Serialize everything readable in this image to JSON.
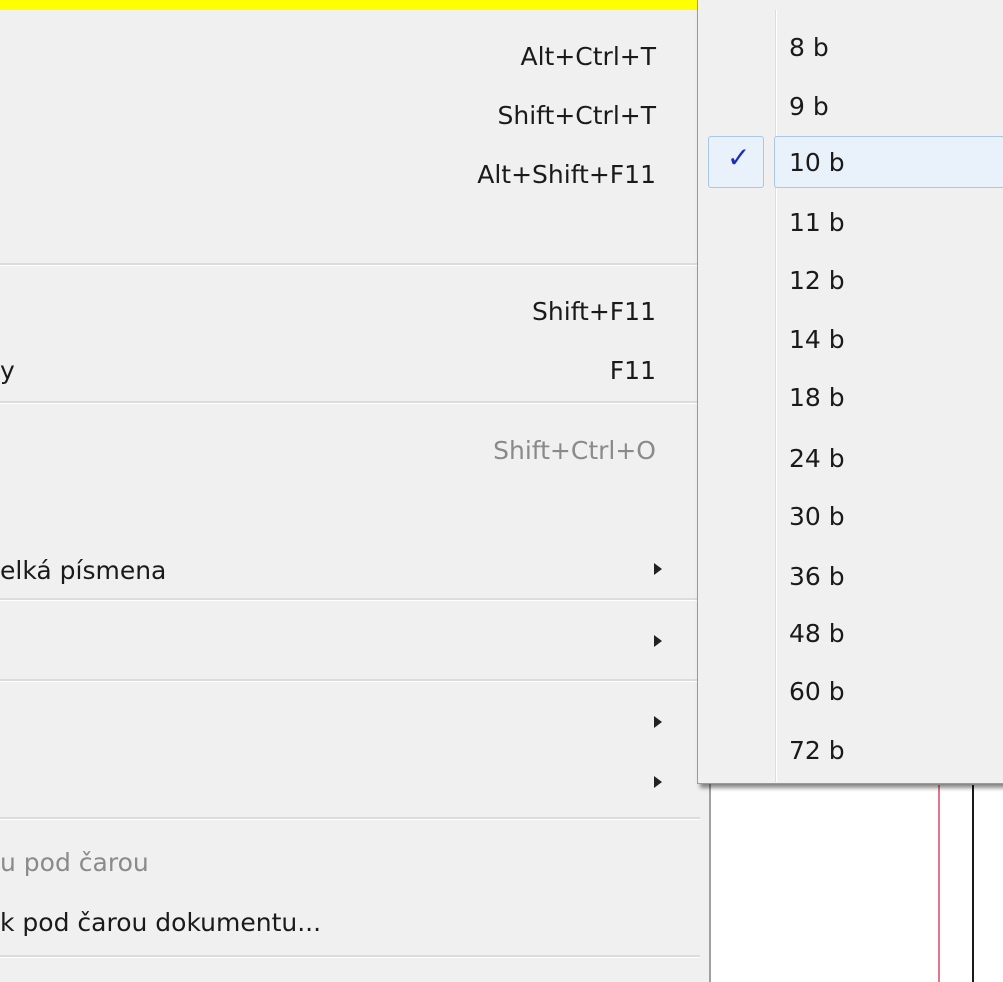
{
  "main_menu": {
    "items": [
      {
        "label": "",
        "shortcut": "Alt+Ctrl+T"
      },
      {
        "label": "",
        "shortcut": "Shift+Ctrl+T"
      },
      {
        "label": "",
        "shortcut": "Alt+Shift+F11"
      },
      {
        "label": "",
        "shortcut": "Shift+F11"
      },
      {
        "label": "y",
        "shortcut": "F11"
      },
      {
        "label": "",
        "shortcut": "Shift+Ctrl+O"
      },
      {
        "label": "elká písmena",
        "shortcut": ""
      },
      {
        "label": "",
        "shortcut": ""
      },
      {
        "label": "",
        "shortcut": ""
      },
      {
        "label": "",
        "shortcut": ""
      },
      {
        "label": "u pod čarou",
        "shortcut": ""
      },
      {
        "label": "k pod čarou dokumentu...",
        "shortcut": ""
      }
    ]
  },
  "font_size_submenu": {
    "items": [
      {
        "label": "8 b"
      },
      {
        "label": "9 b"
      },
      {
        "label": "10 b",
        "selected": true
      },
      {
        "label": "11 b"
      },
      {
        "label": "12 b"
      },
      {
        "label": "14 b"
      },
      {
        "label": "18 b"
      },
      {
        "label": "24 b"
      },
      {
        "label": "30 b"
      },
      {
        "label": "36 b"
      },
      {
        "label": "48 b"
      },
      {
        "label": "60 b"
      },
      {
        "label": "72 b"
      }
    ],
    "check_icon": "checkmark-icon",
    "check_color": "#1a2fb8"
  },
  "colors": {
    "top_bar": "#ffff00",
    "menu_bg": "#f0f0f0",
    "highlight": "#e9f1fb"
  }
}
